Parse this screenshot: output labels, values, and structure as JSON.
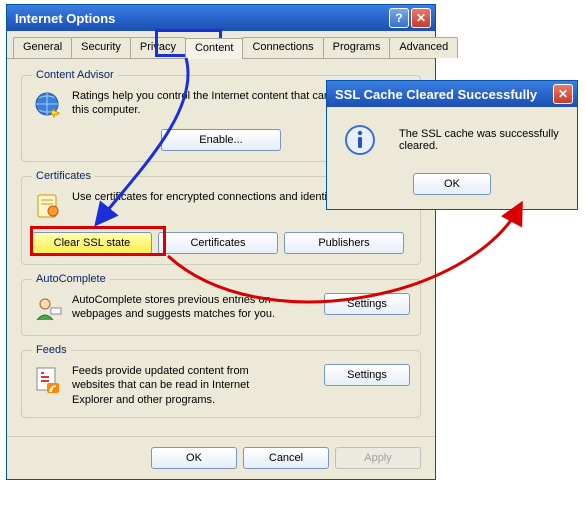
{
  "main": {
    "title": "Internet Options",
    "tabs": [
      "General",
      "Security",
      "Privacy",
      "Content",
      "Connections",
      "Programs",
      "Advanced"
    ],
    "advisor": {
      "legend": "Content Advisor",
      "text": "Ratings help you control the Internet content that can be viewed on this computer.",
      "enable": "Enable..."
    },
    "certs": {
      "legend": "Certificates",
      "text": "Use certificates for encrypted connections and identification.",
      "clear": "Clear SSL state",
      "certificates": "Certificates",
      "publishers": "Publishers"
    },
    "auto": {
      "legend": "AutoComplete",
      "text": "AutoComplete stores previous entries on webpages and suggests matches for you.",
      "settings": "Settings"
    },
    "feeds": {
      "legend": "Feeds",
      "text": "Feeds provide updated content from websites that can be read in Internet Explorer and other programs.",
      "settings": "Settings"
    },
    "ok": "OK",
    "cancel": "Cancel",
    "apply": "Apply"
  },
  "popup": {
    "title": "SSL Cache Cleared Successfully",
    "message": "The SSL cache was successfully cleared.",
    "ok": "OK"
  }
}
